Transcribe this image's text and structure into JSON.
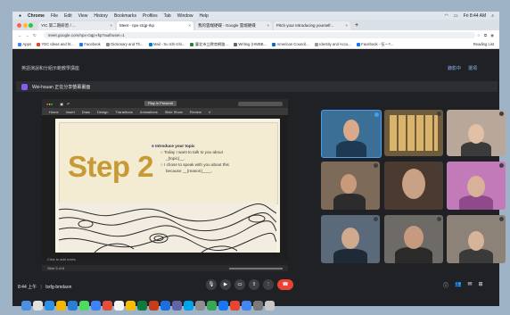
{
  "menubar": {
    "items": [
      "Chrome",
      "File",
      "Edit",
      "View",
      "History",
      "Bookmarks",
      "Profiles",
      "Tab",
      "Window",
      "Help"
    ],
    "clock": "Fri 8:44 AM"
  },
  "tabs": [
    {
      "label": "YIC 第二期研習 / ...",
      "active": false
    },
    {
      "label": "Meet - npx-ctqp-rkp",
      "active": true
    },
    {
      "label": "我的雲端硬碟 - Google 雲端硬碟",
      "active": false
    },
    {
      "label": "Pitch your Introducing yourself...",
      "active": false
    }
  ],
  "address": {
    "url": "meet.google.com/npx-ctqp-rkp?authuser=1"
  },
  "bookmarks": [
    "Apps",
    "YEC Ideas and ht...",
    "Facebook",
    "Dictionary and Th...",
    "Mail - Su Ichi Ichi...",
    "臺北市立教育網路...",
    "Writing (HWBB...",
    "American Council...",
    "Identity and Acco...",
    "Facebook - 伍一?...",
    "Reading List"
  ],
  "meet": {
    "title": "英語演說和分組示範教學講座",
    "top_links": [
      "錄影中",
      "選項"
    ],
    "presenter": "Wei-hsuan 正在分享螢幕畫面",
    "ppt_menu": [
      "Home",
      "Insert",
      "Draw",
      "Design",
      "Transitions",
      "Animations",
      "Slide Show",
      "Review",
      "V"
    ],
    "ppt_present_label": "Play in Presentl",
    "slide": {
      "title": "Step 2",
      "bullet_main": "Introduce your topic",
      "bullet_1a": "Today I want to talk to you about",
      "bullet_1b": "_(topic)__.",
      "bullet_2a": "I chose to speak with you about this",
      "bullet_2b": "because __(reason)____."
    },
    "notes": "Click to add notes",
    "statusline": "Slide 5 of 8",
    "time": "8:44 上午",
    "meeting_code": "bxfg-bmdaon",
    "participants": [
      "",
      "",
      "",
      "",
      "",
      "",
      "",
      "",
      "",
      "",
      "",
      ""
    ]
  },
  "colors": {
    "meet_bg": "#202124",
    "end_call": "#ea4335",
    "slide_title": "#c79a35"
  }
}
